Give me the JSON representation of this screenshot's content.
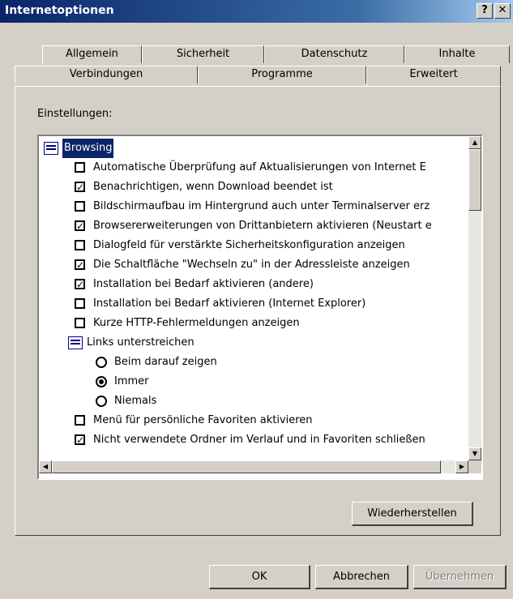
{
  "window": {
    "title": "Internetoptionen",
    "help_label": "?",
    "close_label": "✕"
  },
  "tabs": {
    "row1": [
      "Allgemein",
      "Sicherheit",
      "Datenschutz",
      "Inhalte"
    ],
    "row2": [
      "Verbindungen",
      "Programme",
      "Erweitert"
    ],
    "active": "Erweitert"
  },
  "settings": {
    "label": "Einstellungen:",
    "items": [
      {
        "type": "group",
        "label": "Browsing",
        "selected": true
      },
      {
        "type": "checkbox",
        "checked": false,
        "label": "Automatische Überprüfung auf Aktualisierungen von Internet E"
      },
      {
        "type": "checkbox",
        "checked": true,
        "label": "Benachrichtigen, wenn Download beendet ist"
      },
      {
        "type": "checkbox",
        "checked": false,
        "label": "Bildschirmaufbau im Hintergrund auch unter Terminalserver erz"
      },
      {
        "type": "checkbox",
        "checked": true,
        "label": "Browsererweiterungen von Drittanbietern aktivieren (Neustart e"
      },
      {
        "type": "checkbox",
        "checked": false,
        "label": "Dialogfeld für verstärkte Sicherheitskonfiguration anzeigen"
      },
      {
        "type": "checkbox",
        "checked": true,
        "label": "Die Schaltfläche \"Wechseln zu\" in der Adressleiste anzeigen"
      },
      {
        "type": "checkbox",
        "checked": true,
        "label": "Installation bei Bedarf aktivieren (andere)"
      },
      {
        "type": "checkbox",
        "checked": false,
        "label": "Installation bei Bedarf aktivieren (Internet Explorer)"
      },
      {
        "type": "checkbox",
        "checked": false,
        "label": "Kurze HTTP-Fehlermeldungen anzeigen"
      },
      {
        "type": "subgroup",
        "label": "Links unterstreichen"
      },
      {
        "type": "radio",
        "checked": false,
        "label": "Beim darauf zeigen"
      },
      {
        "type": "radio",
        "checked": true,
        "label": "Immer"
      },
      {
        "type": "radio",
        "checked": false,
        "label": "Niemals"
      },
      {
        "type": "checkbox",
        "checked": false,
        "label": "Menü für persönliche Favoriten aktivieren"
      },
      {
        "type": "checkbox",
        "checked": true,
        "label": "Nicht verwendete Ordner im Verlauf und in Favoriten schließen"
      }
    ]
  },
  "buttons": {
    "restore": "Wiederherstellen",
    "ok": "OK",
    "cancel": "Abbrechen",
    "apply": "Übernehmen"
  },
  "icons": {
    "check": "✓",
    "scroll_up": "▲",
    "scroll_down": "▼",
    "scroll_left": "◀",
    "scroll_right": "▶"
  }
}
